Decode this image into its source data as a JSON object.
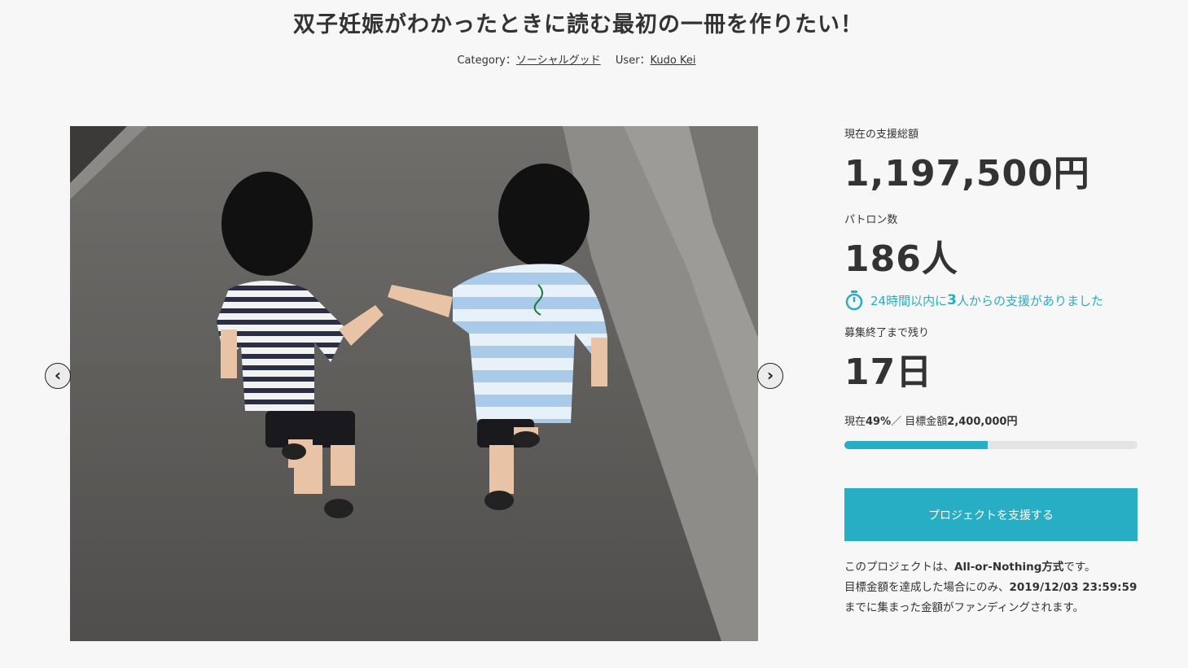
{
  "project": {
    "title": "双子妊娠がわかったときに読む最初の一冊を作りたい！",
    "category_label": "Category：",
    "category": "ソーシャルグッド",
    "user_label": "User：",
    "user": "Kudo Kei"
  },
  "stats": {
    "total_label": "現在の支援総額",
    "total": "1,197,500円",
    "patrons_label": "パトロン数",
    "patrons": "186人",
    "recent_prefix": "24時間以内に",
    "recent_count": "3",
    "recent_suffix": "人からの支援がありました",
    "remaining_label": "募集終了まで残り",
    "remaining": "17日",
    "progress_prefix": "現在",
    "progress_percent": "49%",
    "progress_mid": "／ 目標金額",
    "goal": "2,400,000円",
    "progress_fraction": 0.49
  },
  "cta": {
    "label": "プロジェクトを支援する"
  },
  "note": {
    "line1_prefix": "このプロジェクトは、",
    "line1_bold": "All-or-Nothing方式",
    "line1_suffix": "です。",
    "line2_prefix": "目標金額を達成した場合にのみ、",
    "line2_bold": "2019/12/03 23:59:59",
    "line2_suffix": "までに集まった金額がファンディングされます。"
  },
  "icons": {
    "prev": "chevron-left-icon",
    "next": "chevron-right-icon",
    "timer": "stopwatch-icon"
  },
  "colors": {
    "accent": "#27aec5",
    "text": "#333333",
    "background": "#f7f7f7"
  }
}
